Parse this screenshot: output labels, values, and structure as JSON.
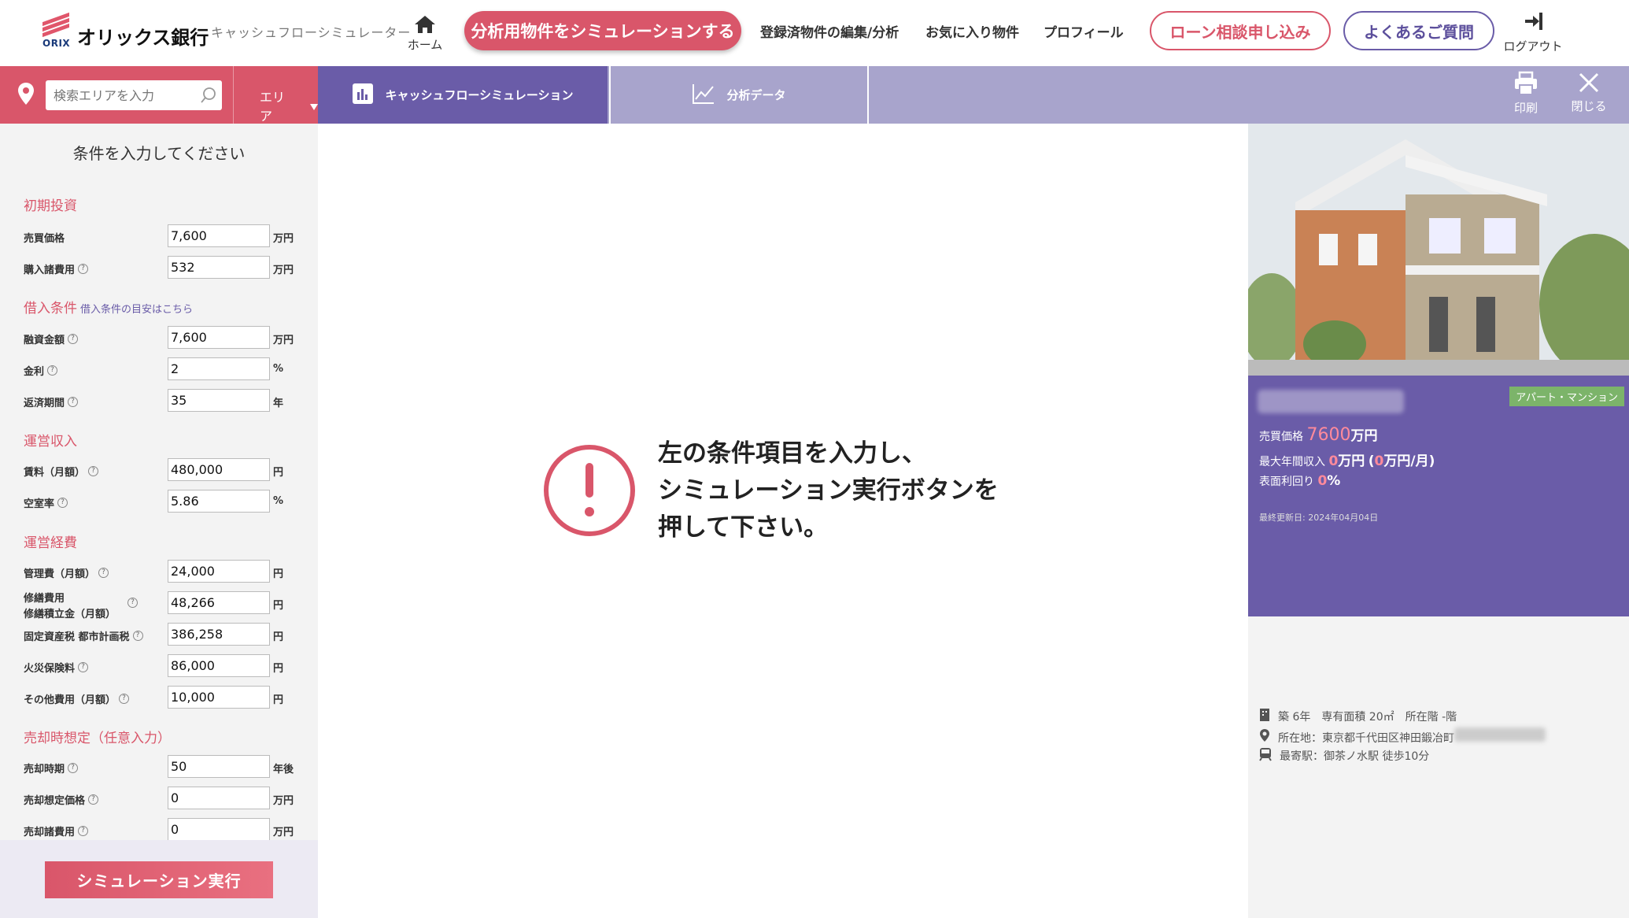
{
  "header": {
    "logo_brand": "ORIX",
    "logo_text": "オリックス銀行",
    "sim_label": "キャッシュフローシミュレーター",
    "home_label": "ホーム",
    "primary_button": "分析用物件をシミュレーションする",
    "nav": [
      "登録済物件の編集/分析",
      "お気に入り物件",
      "プロフィール"
    ],
    "loan_button": "ローン相談申し込み",
    "faq_button": "よくあるご質問",
    "logout_label": "ログアウト"
  },
  "search": {
    "placeholder": "検索エリアを入力",
    "area_label": "エリア"
  },
  "tabs": [
    {
      "label": "キャッシュフローシミュレーション",
      "icon": "bar-chart-icon",
      "active": true
    },
    {
      "label": "分析データ",
      "icon": "line-chart-icon",
      "active": false
    }
  ],
  "toolbar": {
    "print_label": "印刷",
    "close_label": "閉じる"
  },
  "form": {
    "title": "条件を入力してください",
    "sections": {
      "initial": "初期投資",
      "loan": "借入条件",
      "loan_link": "借入条件の目安はこちら",
      "income": "運営収入",
      "expense": "運営経費",
      "sale": "売却時想定（任意入力）"
    },
    "fields": {
      "price": {
        "label": "売買価格",
        "value": "7,600",
        "unit": "万円"
      },
      "purchase_cost": {
        "label": "購入諸費用",
        "value": "532",
        "unit": "万円"
      },
      "loan_amount": {
        "label": "融資金額",
        "value": "7,600",
        "unit": "万円"
      },
      "interest": {
        "label": "金利",
        "value": "2",
        "unit": "%"
      },
      "term": {
        "label": "返済期間",
        "value": "35",
        "unit": "年"
      },
      "rent": {
        "label": "賃料（月額）",
        "value": "480,000",
        "unit": "円"
      },
      "vacancy": {
        "label": "空室率",
        "value": "5.86",
        "unit": "%"
      },
      "mgmt_fee": {
        "label": "管理費（月額）",
        "value": "24,000",
        "unit": "円"
      },
      "repair_l1": "修繕費用",
      "repair_l2": "修繕積立金（月額）",
      "repair": {
        "value": "48,266",
        "unit": "円"
      },
      "tax": {
        "label": "固定資産税 都市計画税",
        "value": "386,258",
        "unit": "円"
      },
      "fire": {
        "label": "火災保険料",
        "value": "86,000",
        "unit": "円"
      },
      "other": {
        "label": "その他費用（月額）",
        "value": "10,000",
        "unit": "円"
      },
      "sale_time": {
        "label": "売却時期",
        "value": "50",
        "unit": "年後"
      },
      "sale_price": {
        "label": "売却想定価格",
        "value": "0",
        "unit": "万円"
      },
      "sale_cost": {
        "label": "売却諸費用",
        "value": "0",
        "unit": "万円"
      }
    },
    "run_button": "シミュレーション実行"
  },
  "main": {
    "message_lines": [
      "左の条件項目を入力し、",
      "シミュレーション実行ボタンを",
      "押して下さい。"
    ],
    "alert_color": "#d9566a"
  },
  "property": {
    "type_badge": "アパート・マンション",
    "price_label": "売買価格",
    "price_value": "7600",
    "price_unit": "万円",
    "income_label": "最大年間収入",
    "income_value": "0",
    "income_unit": "万円",
    "income_monthly_value": "0",
    "income_monthly_unit": "万円/月",
    "yield_label": "表面利回り",
    "yield_value": "0",
    "yield_unit": "%",
    "updated": "最終更新日: 2024年04月04日",
    "building": "築 6年　専有面積 20㎡　所在階 -階",
    "address_label": "所在地：",
    "address_value": "東京都千代田区神田鍛冶町",
    "station_label": "最寄駅：",
    "station_value": "御茶ノ水駅 徒歩10分"
  },
  "colors": {
    "accent_red": "#d9566a",
    "accent_purple": "#6a5ca8",
    "tab_inactive": "#a8a4cc"
  }
}
